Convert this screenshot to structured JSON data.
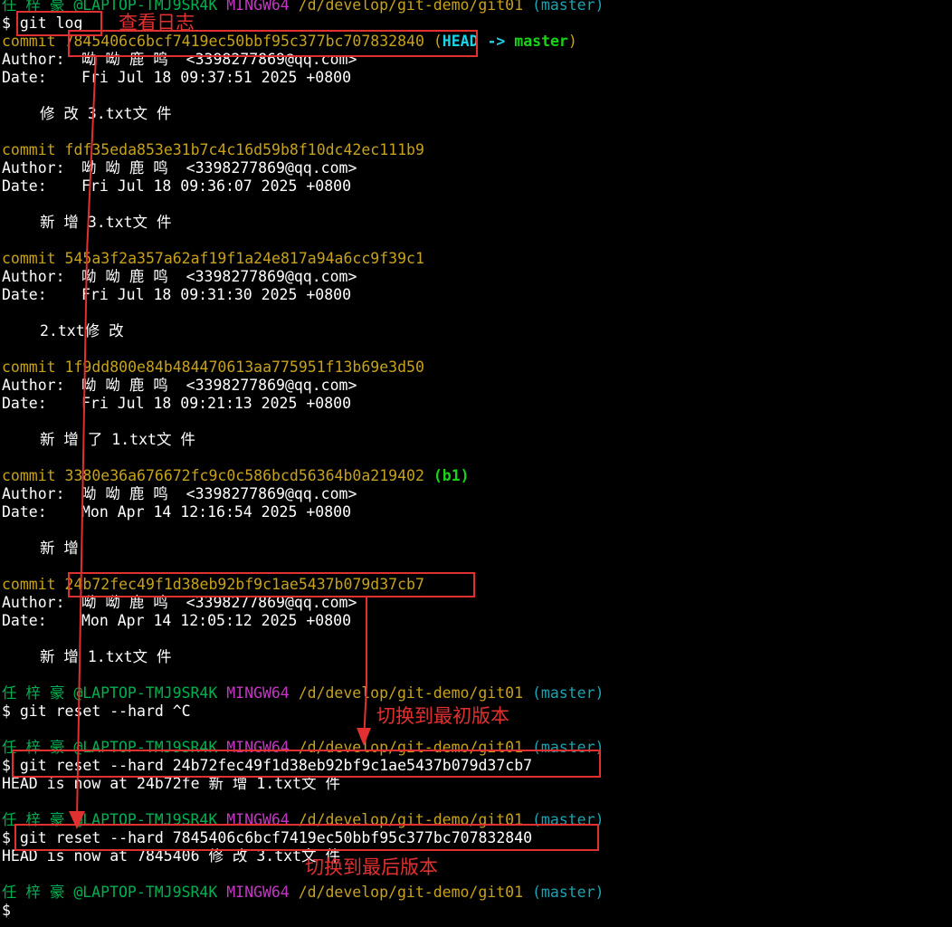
{
  "prompt": {
    "user": "任 梓 豪",
    "host": "@LAPTOP-TMJ9SR4K",
    "shell": "MINGW64",
    "path": "/d/develop/git-demo/git01",
    "branch": "(master)",
    "symbol": "$"
  },
  "commands": {
    "log": "git log",
    "reset_cancelled": "git reset --hard ^C",
    "reset_first": "git reset --hard 24b72fec49f1d38eb92bf9c1ae5437b079d37cb7",
    "reset_last": "git reset --hard 7845406c6bcf7419ec50bbf95c377bc707832840"
  },
  "labels": {
    "commit": "commit",
    "author": "Author:",
    "date": "Date:"
  },
  "commits": [
    {
      "hash": "7845406c6bcf7419ec50bbf95c377bc707832840",
      "ref_open": "(",
      "ref_head": "HEAD ->",
      "ref_branch": "master",
      "ref_close": ")",
      "author": "呦 呦 鹿 鸣  <3398277869@qq.com>",
      "date": "Fri Jul 18 09:37:51 2025 +0800",
      "message": "修 改 3.txt文 件"
    },
    {
      "hash": "fdf35eda853e31b7c4c16d59b8f10dc42ec111b9",
      "author": "呦 呦 鹿 鸣  <3398277869@qq.com>",
      "date": "Fri Jul 18 09:36:07 2025 +0800",
      "message": "新 增 3.txt文 件"
    },
    {
      "hash": "545a3f2a357a62af19f1a24e817a94a6cc9f39c1",
      "author": "呦 呦 鹿 鸣  <3398277869@qq.com>",
      "date": "Fri Jul 18 09:31:30 2025 +0800",
      "message": "2.txt修 改"
    },
    {
      "hash": "1f9dd800e84b484470613aa775951f13b69e3d50",
      "author": "呦 呦 鹿 鸣  <3398277869@qq.com>",
      "date": "Fri Jul 18 09:21:13 2025 +0800",
      "message": "新 增 了 1.txt文 件"
    },
    {
      "hash": "3380e36a676672fc9c0c586bcd56364b0a219402",
      "ref": "(b1)",
      "author": "呦 呦 鹿 鸣  <3398277869@qq.com>",
      "date": "Mon Apr 14 12:16:54 2025 +0800",
      "message": "新 增"
    },
    {
      "hash": "24b72fec49f1d38eb92bf9c1ae5437b079d37cb7",
      "author": "呦 呦 鹿 鸣  <3398277869@qq.com>",
      "date": "Mon Apr 14 12:05:12 2025 +0800",
      "message": "新 增 1.txt文 件"
    }
  ],
  "outputs": {
    "reset_first": "HEAD is now at 24b72fe 新 增 1.txt文 件",
    "reset_last": "HEAD is now at 7845406 修 改 3.txt文 件"
  },
  "annotations": {
    "view_log": "查看日志",
    "switch_first": "切换到最初版本",
    "switch_last": "切换到最后版本",
    "color": "#e03030"
  },
  "colors": {
    "background": "#000000",
    "user": "#00b050",
    "shell": "#c337c3",
    "path": "#c7a21a",
    "branch": "#1aa3b2",
    "commit": "#c7a21a",
    "head": "#19d3e6",
    "master": "#19d319"
  }
}
